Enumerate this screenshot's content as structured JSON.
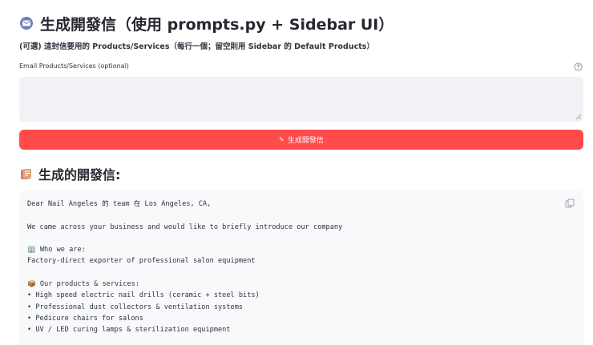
{
  "header": {
    "icon": "envelope-icon",
    "title": "生成開發信（使用 prompts.py + Sidebar UI）"
  },
  "subtitle": "(可選) 這封信要用的 Products/Services（每行一個；留空則用 Sidebar 的 Default Products）",
  "email_products": {
    "label": "Email Products/Services (optional)",
    "value": "",
    "placeholder": ""
  },
  "generate_button": {
    "icon": "pencil-icon",
    "label": "生成開發信"
  },
  "result": {
    "icon": "letter-icon",
    "title": "生成的開發信:",
    "lines": [
      "Dear Nail Angeles 的 team 在 Los Angeles, CA,",
      "",
      "We came across your business and would like to briefly introduce our company",
      "",
      "🏢 Who we are:",
      "Factory-direct exporter of professional salon equipment",
      "",
      "📦 Our products & services:",
      "• High speed electric nail drills (ceramic + steel bits)",
      "• Professional dust collectors & ventilation systems",
      "• Pedicure chairs for salons",
      "• UV / LED curing lamps & sterilization equipment"
    ]
  },
  "colors": {
    "primary": "#ff4b4b",
    "input_bg": "#f0f2f6",
    "code_bg": "#f8f9fb",
    "text": "#31333f"
  }
}
